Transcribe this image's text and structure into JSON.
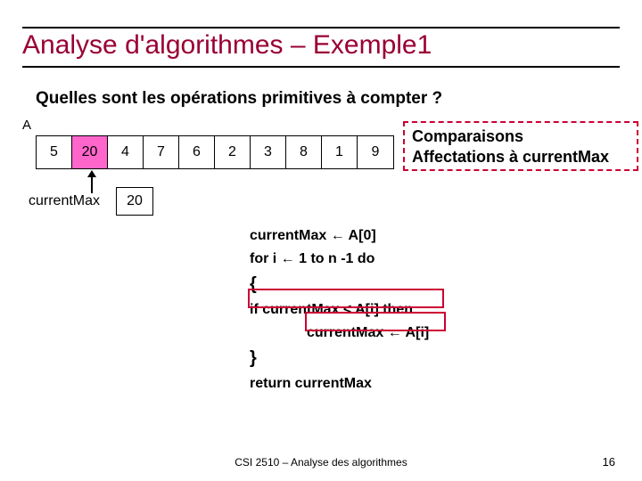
{
  "title": "Analyse d'algorithmes – Exemple1",
  "subtitle": "Quelles sont les opérations primitives à compter ?",
  "array_label": "A",
  "array_values": [
    "5",
    "20",
    "4",
    "7",
    "6",
    "2",
    "3",
    "8",
    "1",
    "9"
  ],
  "highlight_index": "1",
  "current_max_label": "currentMax",
  "current_max_value": "20",
  "ops": {
    "line1": "Comparaisons",
    "line2": "Affectations à currentMax"
  },
  "algo": {
    "l1a": "currentMax ",
    "l1b": " A[0]",
    "l2a": "for i ",
    "l2b": " 1 to n -1 do",
    "l3": "{",
    "l4": "if currentMax < A[i] then",
    "l5a": "currentMax ",
    "l5b": " A[i]",
    "l6": "}",
    "l7": "return currentMax"
  },
  "arrow_glyph": "←",
  "footer": "CSI 2510 – Analyse des algorithmes",
  "page": "16"
}
